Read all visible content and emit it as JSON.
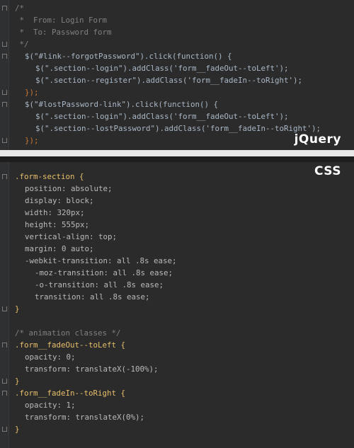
{
  "badges": {
    "jquery": "jQuery",
    "css": "CSS"
  },
  "js_lines": [
    "/*",
    " *  From: Login Form",
    " *  To: Password form",
    " */",
    "$(\"#link--forgotPassword\").click(function() {",
    "$(\".section--login\").addClass('form__fadeOut--toLeft');",
    "$(\".section--register\").addClass('form__fadeIn--toRight');",
    "});",
    "$(\"#lostPassword-link\").click(function() {",
    "$(\".section--login\").addClass('form__fadeOut--toLeft');",
    "$(\".section--lostPassword\").addClass('form__fadeIn--toRight');",
    "});"
  ],
  "css_lines": [
    ".form-section {",
    "position: absolute;",
    "display: block;",
    "width: 320px;",
    "height: 555px;",
    "vertical-align: top;",
    "margin: 0 auto;",
    "-webkit-transition: all .8s ease;",
    "-moz-transition: all .8s ease;",
    "-o-transition: all .8s ease;",
    "transition: all .8s ease;",
    "}",
    "",
    "/* animation classes */",
    ".form__fadeOut--toLeft {",
    "opacity: 0;",
    "transform: translateX(-100%);",
    "}",
    ".form__fadeIn--toRight {",
    "opacity: 1;",
    "transform: translateX(0%);",
    "}"
  ]
}
